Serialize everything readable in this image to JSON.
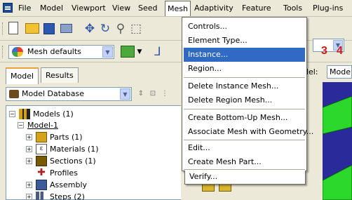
{
  "menubar": {
    "items": [
      "File",
      "Model",
      "Viewport",
      "View",
      "Seed",
      "Mesh",
      "Adaptivity",
      "Feature",
      "Tools",
      "Plug-ins"
    ],
    "active": "Mesh"
  },
  "toolbar2": {
    "mesh_defaults": "Mesh defaults"
  },
  "steps_indicator": [
    "3",
    "4"
  ],
  "viewport": {
    "model_label": "del:",
    "model_value": "Model-"
  },
  "left_panel": {
    "tabs": [
      "Model",
      "Results"
    ],
    "active_tab": "Model",
    "database_combo": "Model Database"
  },
  "tree": {
    "nodes": [
      {
        "label": "Models (1)",
        "expander": "−"
      },
      {
        "label": "Model-1",
        "expander": "−"
      },
      {
        "label": "Parts (1)",
        "expander": "+"
      },
      {
        "label": "Materials (1)",
        "expander": "+"
      },
      {
        "label": "Sections (1)",
        "expander": "+"
      },
      {
        "label": "Profiles",
        "expander": ""
      },
      {
        "label": "Assembly",
        "expander": "+"
      },
      {
        "label": "Steps (2)",
        "expander": "+"
      }
    ]
  },
  "mesh_menu": {
    "items": [
      {
        "label": "Controls..."
      },
      {
        "label": "Element Type..."
      },
      {
        "label": "Instance...",
        "highlighted": true
      },
      {
        "label": "Region..."
      },
      {
        "label": "Delete Instance Mesh..."
      },
      {
        "label": "Delete Region Mesh..."
      },
      {
        "label": "Create Bottom-Up Mesh..."
      },
      {
        "label": "Associate Mesh with Geometry..."
      },
      {
        "label": "Edit..."
      },
      {
        "label": "Create Mesh Part..."
      },
      {
        "label": "Verify..."
      }
    ]
  },
  "colors": {
    "menu_highlight": "#316ac5",
    "step_numbers": "#d01818",
    "viewport_bg": "#2a2a9a",
    "viewport_shape": "#2bd82b",
    "chrome": "#ece9d8"
  }
}
